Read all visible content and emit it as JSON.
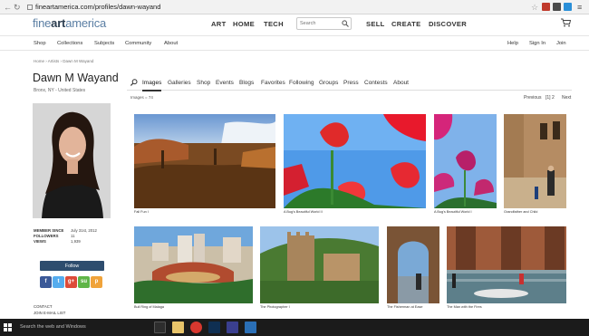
{
  "browser": {
    "url": "fineartamerica.com/profiles/dawn-wayand"
  },
  "site": {
    "logo_light": "fine",
    "logo_bold": "art",
    "logo_tail": "america",
    "top_nav": [
      "ART",
      "HOME",
      "TECH"
    ],
    "search_placeholder": "Search",
    "right_nav": [
      "SELL",
      "CREATE",
      "DISCOVER"
    ],
    "sub_nav_left": [
      "Shop",
      "Collections",
      "Subjects",
      "Community",
      "About"
    ],
    "sub_nav_right": [
      "Help",
      "Sign In",
      "Join"
    ]
  },
  "breadcrumb": "Home › Artists › Dawn M Wayand",
  "profile": {
    "name": "Dawn M Wayand",
    "location": "Bronx, NY - United States",
    "stats": [
      {
        "label": "MEMBER SINCE",
        "value": "July 31st, 2012"
      },
      {
        "label": "FOLLOWERS",
        "value": "11"
      },
      {
        "label": "VIEWS",
        "value": "1,939"
      }
    ],
    "follow_label": "Follow",
    "social": [
      {
        "icon": "facebook-icon",
        "glyph": "f",
        "color": "#3b5998"
      },
      {
        "icon": "twitter-icon",
        "glyph": "t",
        "color": "#55acee"
      },
      {
        "icon": "google-plus-icon",
        "glyph": "g+",
        "color": "#dd4b39"
      },
      {
        "icon": "stumbleupon-icon",
        "glyph": "su",
        "color": "#5fb548"
      },
      {
        "icon": "pinterest-icon",
        "glyph": "p",
        "color": "#f0a33a"
      }
    ],
    "contact_label": "CONTACT",
    "email_list_label": "JOIN E-MAIL LIST"
  },
  "tabs": [
    "Images",
    "Galleries",
    "Shop",
    "Events",
    "Blogs",
    "Favorites",
    "Following",
    "Groups",
    "Press",
    "Contests",
    "About"
  ],
  "active_tab": "Images",
  "images_count": "Images = 74",
  "pagination": {
    "previous": "Previous",
    "pages": "[1]  2",
    "next": "Next"
  },
  "images_row1": [
    {
      "caption": "Fall Fun I"
    },
    {
      "caption": "A Bug's Beautiful World II"
    },
    {
      "caption": "A Bug's Beautiful World I"
    },
    {
      "caption": "Grandfather and Child"
    }
  ],
  "images_row2": [
    {
      "caption": "Bull Ring of Malaga"
    },
    {
      "caption": "The Photographer I"
    },
    {
      "caption": "The Fisherman at Ease"
    },
    {
      "caption": "The Man with the Fires"
    }
  ],
  "taskbar": {
    "search_text": "Search the web and Windows"
  },
  "colors": {
    "brand_blue": "#5a7ea3",
    "follow_button": "#2e4d6e",
    "taskbar": "#1b1b1b"
  }
}
